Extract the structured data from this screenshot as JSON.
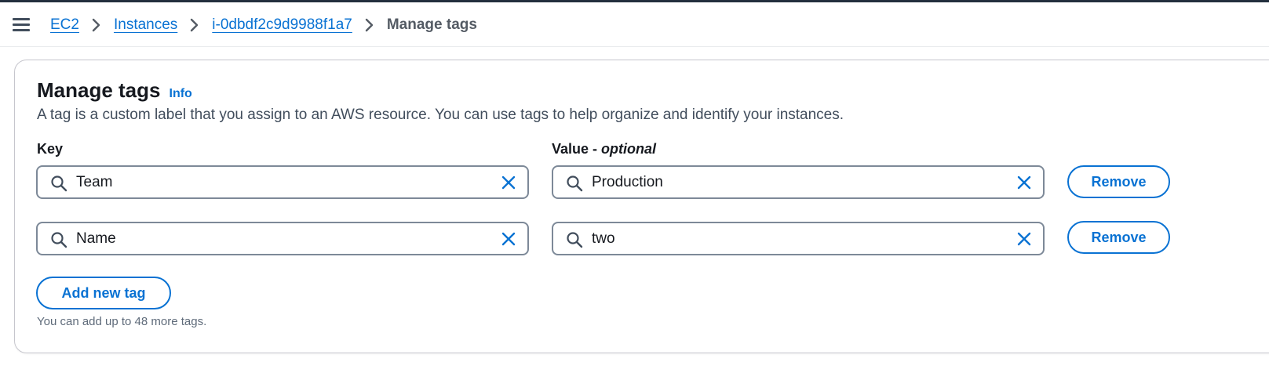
{
  "breadcrumb": {
    "items": [
      {
        "label": "EC2"
      },
      {
        "label": "Instances"
      },
      {
        "label": "i-0dbdf2c9d9988f1a7"
      }
    ],
    "current": "Manage tags"
  },
  "panel": {
    "title": "Manage tags",
    "info_label": "Info",
    "description": "A tag is a custom label that you assign to an AWS resource. You can use tags to help organize and identify your instances.",
    "key_label": "Key",
    "value_label": "Value - ",
    "value_label_optional": "optional",
    "tags": [
      {
        "key": "Team",
        "value": "Production",
        "remove_label": "Remove"
      },
      {
        "key": "Name",
        "value": "two",
        "remove_label": "Remove"
      }
    ],
    "add_label": "Add new tag",
    "hint": "You can add up to 48 more tags."
  },
  "colors": {
    "link": "#0972d3",
    "border": "#7d8998",
    "topbar": "#232f3e"
  },
  "icons": [
    "menu-icon",
    "chevron-right-icon",
    "search-icon",
    "close-icon"
  ]
}
